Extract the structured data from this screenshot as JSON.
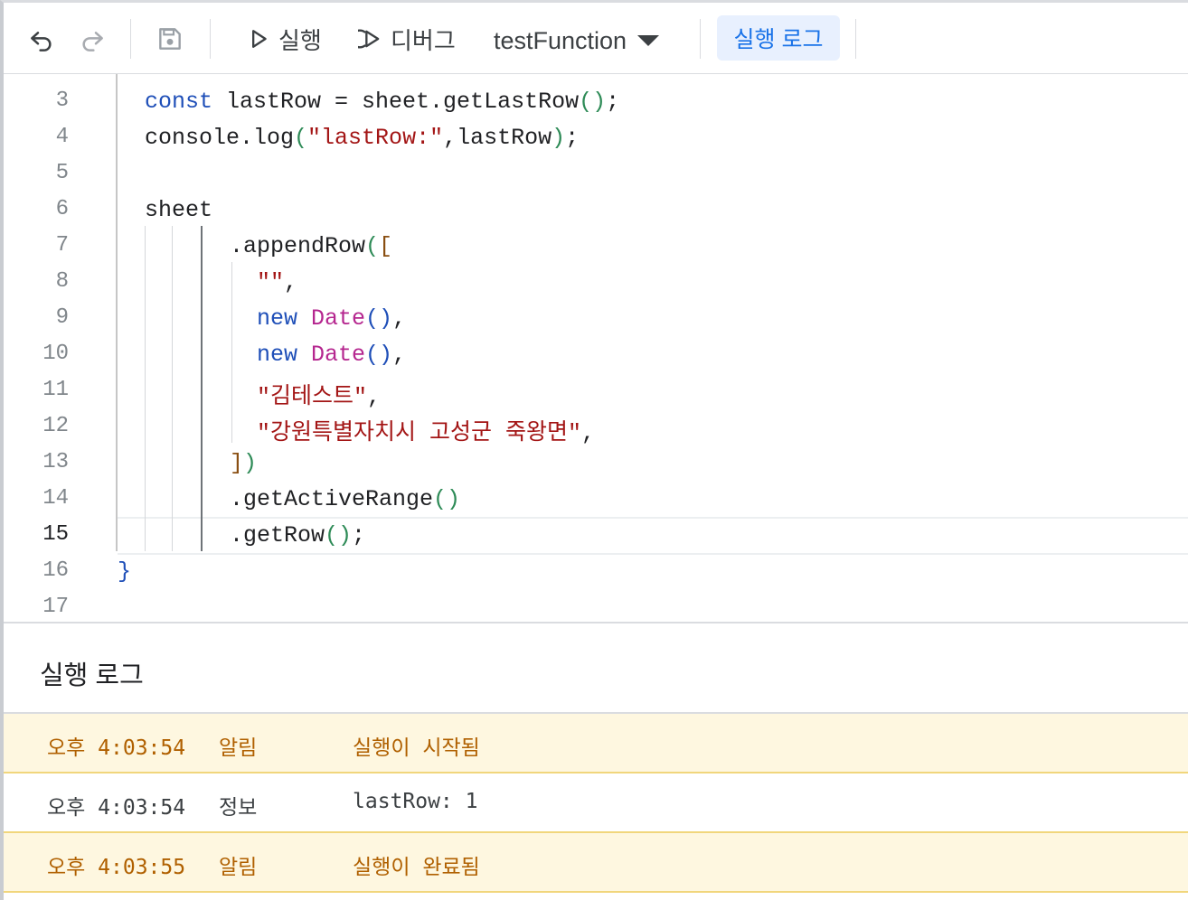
{
  "toolbar": {
    "undo_icon": "undo-icon",
    "redo_icon": "redo-icon",
    "save_icon": "save-icon",
    "run_label": "실행",
    "debug_label": "디버그",
    "function_name": "testFunction",
    "exec_log_label": "실행 로그"
  },
  "editor": {
    "line_numbers": [
      "3",
      "4",
      "5",
      "6",
      "7",
      "8",
      "9",
      "10",
      "11",
      "12",
      "13",
      "14",
      "15",
      "16",
      "17"
    ],
    "active_line": "15",
    "code": {
      "l3_const": "const",
      "l3_rest": " lastRow = sheet.getLastRow",
      "l3_parens": "()",
      "l3_semi": ";",
      "l4_a": "console.log",
      "l4_paren_open": "(",
      "l4_str": "\"lastRow:\"",
      "l4_mid": ",lastRow",
      "l4_paren_close": ")",
      "l4_semi": ";",
      "l6": "sheet",
      "l7_method": ".appendRow",
      "l7_paren": "(",
      "l7_bracket": "[",
      "l8_str": "\"\"",
      "l8_comma": ",",
      "l9_new": "new",
      "l9_cls": "Date",
      "l9_parens": "()",
      "l9_comma": ",",
      "l10_new": "new",
      "l10_cls": "Date",
      "l10_parens": "()",
      "l10_comma": ",",
      "l11_str": "\"김테스트\"",
      "l11_comma": ",",
      "l12_str": "\"강원특별자치시 고성군 죽왕면\"",
      "l12_comma": ",",
      "l13_bracket": "]",
      "l13_paren": ")",
      "l14_method": ".getActiveRange",
      "l14_parens": "()",
      "l15_method": ".getRow",
      "l15_parens": "()",
      "l15_semi": ";",
      "l16_brace": "}"
    }
  },
  "log": {
    "title": "실행 로그",
    "entries": [
      {
        "time": "오후 4:03:54",
        "level": "알림",
        "message": "실행이 시작됨"
      },
      {
        "time": "오후 4:03:54",
        "level": "정보",
        "message": "lastRow: 1"
      },
      {
        "time": "오후 4:03:55",
        "level": "알림",
        "message": "실행이 완료됨"
      }
    ]
  }
}
